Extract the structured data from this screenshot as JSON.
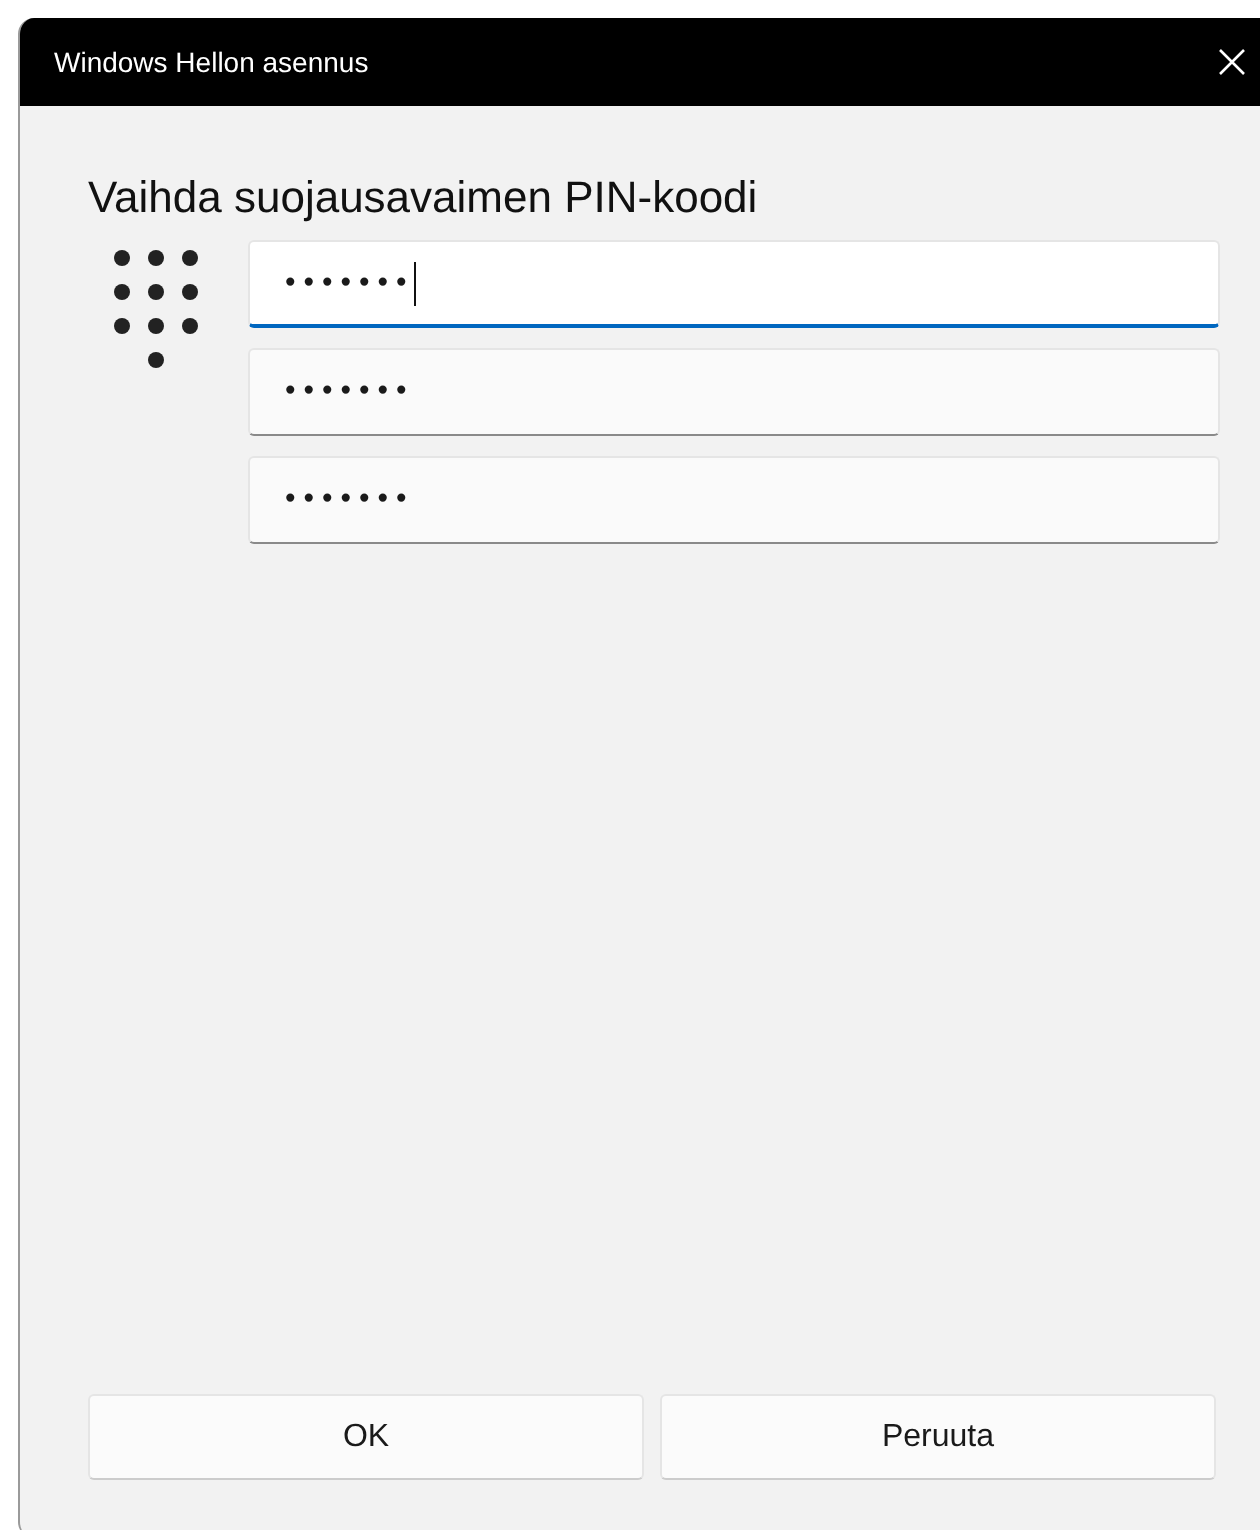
{
  "window": {
    "title": "Windows Hellon asennus"
  },
  "heading": "Vaihda suojausavaimen PIN-koodi",
  "fields": [
    {
      "value": "•••••••",
      "focused": true
    },
    {
      "value": "•••••••",
      "focused": false
    },
    {
      "value": "•••••••",
      "focused": false
    }
  ],
  "buttons": [
    "OK",
    "Peruuta"
  ]
}
